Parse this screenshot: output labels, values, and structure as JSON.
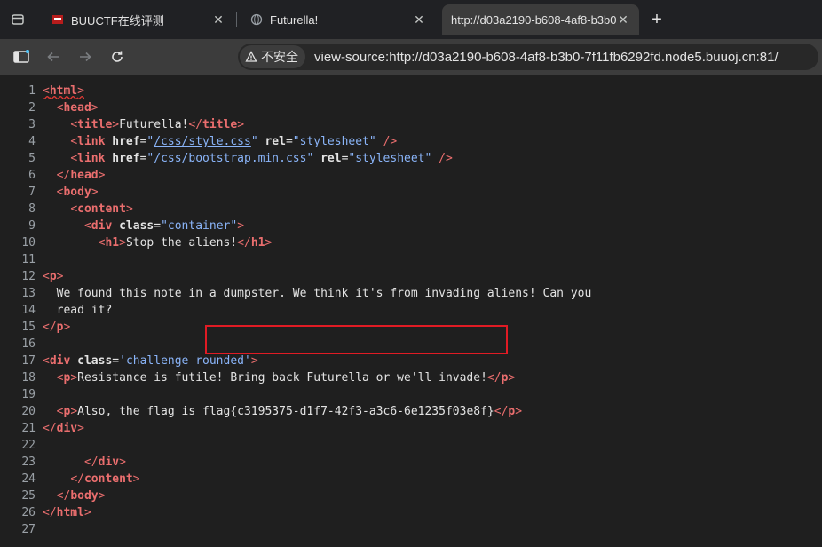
{
  "tabs": [
    {
      "title": "BUUCTF在线评测",
      "active": false
    },
    {
      "title": "Futurella!",
      "active": false
    },
    {
      "title": "http://d03a2190-b608-4af8-b3b0",
      "active": true
    }
  ],
  "toolbar": {
    "security_label": "不安全",
    "url": "view-source:http://d03a2190-b608-4af8-b3b0-7f11fb6292fd.node5.buuoj.cn:81/"
  },
  "source": {
    "line_numbers": [
      "1",
      "2",
      "3",
      "4",
      "5",
      "6",
      "7",
      "8",
      "9",
      "10",
      "11",
      "12",
      "13",
      "14",
      "15",
      "16",
      "17",
      "18",
      "19",
      "20",
      "21",
      "22",
      "23",
      "24",
      "25",
      "26",
      "27"
    ],
    "title_text": "Futurella!",
    "link1_href": "/css/style.css",
    "link2_href": "/css/bootstrap.min.css",
    "rel_value": "stylesheet",
    "div_class": "container",
    "h1_text": "Stop the aliens!",
    "p1_line1": "We found this note in a dumpster. We think it's from invading aliens! Can you",
    "p1_line2": "read it?",
    "challenge_class": "challenge rounded",
    "p2_text": "Resistance is futile! Bring back Futurella or we'll invade!",
    "p3_prefix": "Also, the flag is ",
    "flag": "flag{c3195375-d1f7-42f3-a3c6-6e1235f03e8f}"
  },
  "colors": {
    "tag": "#ea6e6e",
    "attr_value": "#8ab4f8",
    "highlight": "#e01b24",
    "background": "#1f1f1f"
  }
}
